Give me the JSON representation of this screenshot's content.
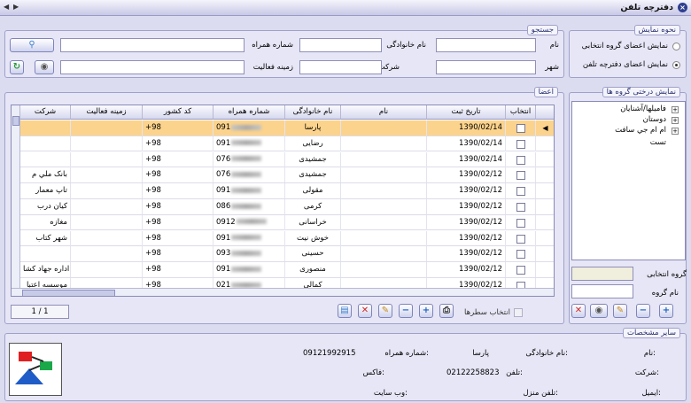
{
  "window": {
    "title": "دفترچه تلفن",
    "nav_prev": "◀",
    "nav_next": "▶"
  },
  "display_mode": {
    "title": "نحوه نمایش",
    "opt_selected_group": "نمایش اعضای گروه انتخابی",
    "opt_all": "نمایش اعضای دفترچه تلفن"
  },
  "search": {
    "title": "جستجو",
    "name": "نام",
    "family": "نام خانوادگی",
    "mobile": "شماره همراه",
    "city": "شهر",
    "company": "شرکت",
    "field": "زمینه فعالیت"
  },
  "tree": {
    "title": "نمایش درختی گروه ها",
    "items": [
      "فامیلها/آشنایان",
      "دوستان",
      "ام ام جي سافت",
      "تست"
    ],
    "selected_group_label": "گروه انتخابی",
    "group_name_label": "نام گروه"
  },
  "members": {
    "title": "اعضا",
    "columns": [
      "انتخاب",
      "تاریخ ثبت",
      "نام",
      "نام خانوادگی",
      "شماره همراه",
      "کد کشور",
      "زمینه فعالیت",
      "شرکت"
    ],
    "rows": [
      {
        "date": "1390/02/14",
        "first": "",
        "last": "پارسا",
        "mobile": "091",
        "cc": "+98",
        "field": "",
        "company": ""
      },
      {
        "date": "1390/02/14",
        "first": "",
        "last": "رضایی",
        "mobile": "091",
        "cc": "+98",
        "field": "",
        "company": ""
      },
      {
        "date": "1390/02/14",
        "first": "",
        "last": "جمشیدی",
        "mobile": "076",
        "cc": "+98",
        "field": "",
        "company": ""
      },
      {
        "date": "1390/02/12",
        "first": "",
        "last": "جمشیدی",
        "mobile": "076",
        "cc": "+98",
        "field": "",
        "company": "بانک ملي م"
      },
      {
        "date": "1390/02/12",
        "first": "",
        "last": "مقولی",
        "mobile": "091",
        "cc": "+98",
        "field": "",
        "company": "تاپ معمار"
      },
      {
        "date": "1390/02/12",
        "first": "",
        "last": "کرمی",
        "mobile": "086",
        "cc": "+98",
        "field": "",
        "company": "کیان درب"
      },
      {
        "date": "1390/02/12",
        "first": "",
        "last": "خراسانی",
        "mobile": "0912",
        "cc": "+98",
        "field": "",
        "company": "مغازه"
      },
      {
        "date": "1390/02/12",
        "first": "",
        "last": "خوش نیت",
        "mobile": "091",
        "cc": "+98",
        "field": "",
        "company": "شهر کتاب"
      },
      {
        "date": "1390/02/12",
        "first": "",
        "last": "حسینی",
        "mobile": "093",
        "cc": "+98",
        "field": "",
        "company": ""
      },
      {
        "date": "1390/02/12",
        "first": "",
        "last": "منصوری",
        "mobile": "091",
        "cc": "+98",
        "field": "",
        "company": "اداره جهاد کشا"
      },
      {
        "date": "1390/02/12",
        "first": "",
        "last": "کمالی",
        "mobile": "021",
        "cc": "+98",
        "field": "",
        "company": "موسسه اعتبا"
      }
    ],
    "pager": "1 / 1",
    "select_rows": "انتخاب سطرها"
  },
  "details": {
    "title": "سایر مشخصات",
    "name_label": "نام:",
    "family_label": "نام خانوادگی:",
    "family_value": "پارسا",
    "mobile_label": "شماره همراه:",
    "mobile_value": "09121992915",
    "company_label": "شرکت:",
    "phone_label": "تلفن:",
    "phone_value": "02122258823",
    "fax_label": "فاکس:",
    "email_label": "ایمیل:",
    "home_label": "تلفن منزل:",
    "web_label": "وب سایت:"
  }
}
